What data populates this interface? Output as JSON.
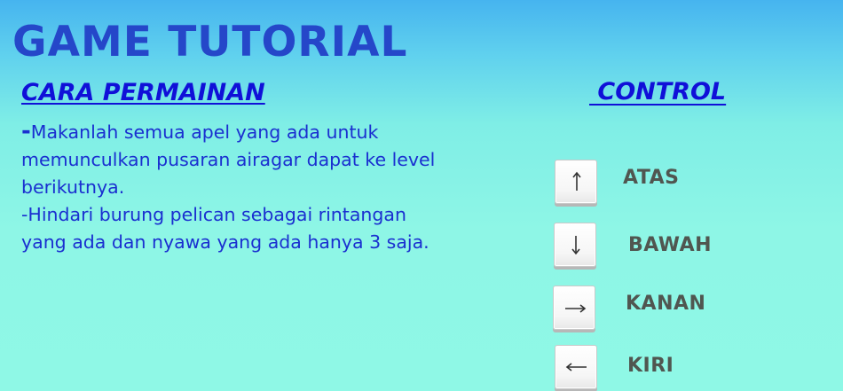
{
  "title": "GAME TUTORIAL",
  "how_to_play": {
    "heading": "CARA PERMAINAN",
    "lines": [
      {
        "dash": "-",
        "text": "Makanlah semua apel yang ada untuk memunculkan pusaran airagar dapat ke level berikutnya."
      },
      {
        "dash": "-",
        "text": "Hindari burung pelican sebagai rintangan yang ada dan nyawa yang ada hanya 3 saja."
      }
    ]
  },
  "controls": {
    "heading": " CONTROL",
    "items": [
      {
        "key": "up-arrow",
        "label": "ATAS"
      },
      {
        "key": "down-arrow",
        "label": "BAWAH"
      },
      {
        "key": "right-arrow",
        "label": "KANAN"
      },
      {
        "key": "left-arrow",
        "label": "KIRI"
      }
    ]
  },
  "colors": {
    "title": "#2547c9",
    "heading": "#1010d8",
    "body_text": "#1a2fd0",
    "key_label": "#505650"
  }
}
